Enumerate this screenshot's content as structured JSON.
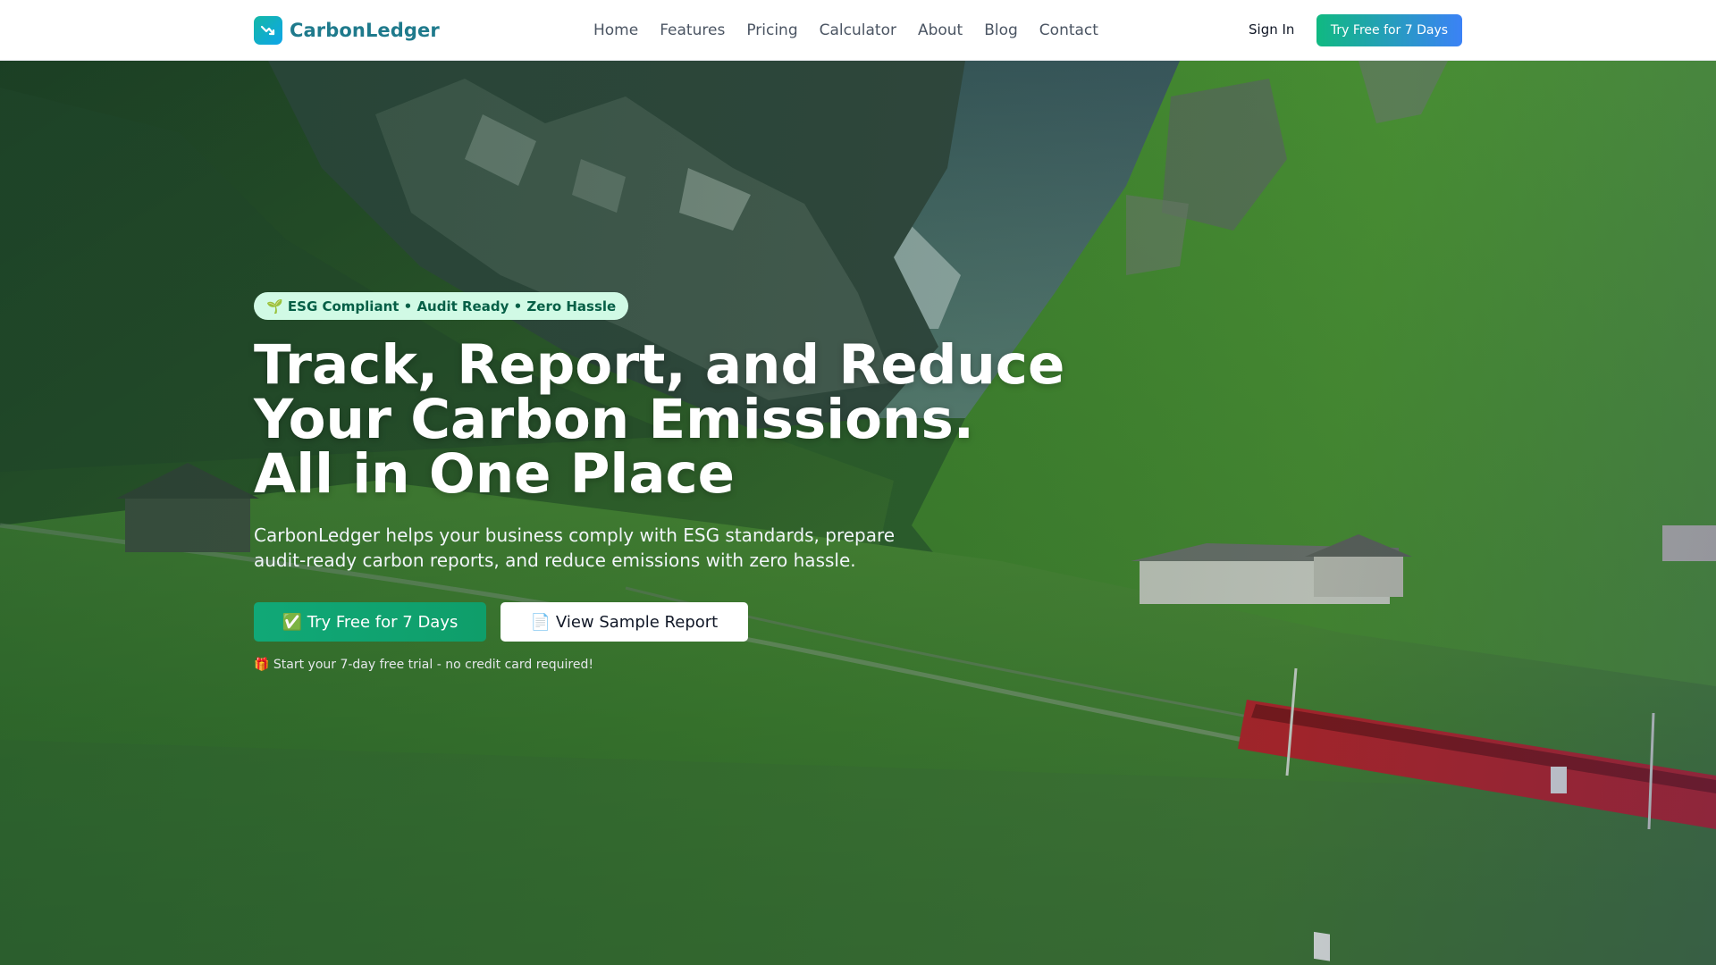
{
  "brand": {
    "name": "CarbonLedger",
    "logo_icon": "trend-down-icon",
    "primary_color": "#10b981",
    "accent_color": "#3b82f6"
  },
  "nav": {
    "links": [
      "Home",
      "Features",
      "Pricing",
      "Calculator",
      "About",
      "Blog",
      "Contact"
    ],
    "sign_in": "Sign In",
    "cta": "Try Free for 7 Days"
  },
  "hero": {
    "background": "mountain valley with green meadows and a red train",
    "badge": "🌱 ESG Compliant • Audit Ready • Zero Hassle",
    "headline": [
      "Track, Report, and Reduce",
      "Your Carbon Emissions.",
      "All in One Place"
    ],
    "subheadline": [
      "CarbonLedger helps your business comply with ESG standards, prepare",
      "audit-ready carbon reports, and reduce emissions with zero hassle."
    ],
    "primary_cta": "✅ Try Free for 7 Days",
    "secondary_cta": "📄 View Sample Report",
    "trial_note": "🎁 Start your 7-day free trial - no credit card required!"
  }
}
